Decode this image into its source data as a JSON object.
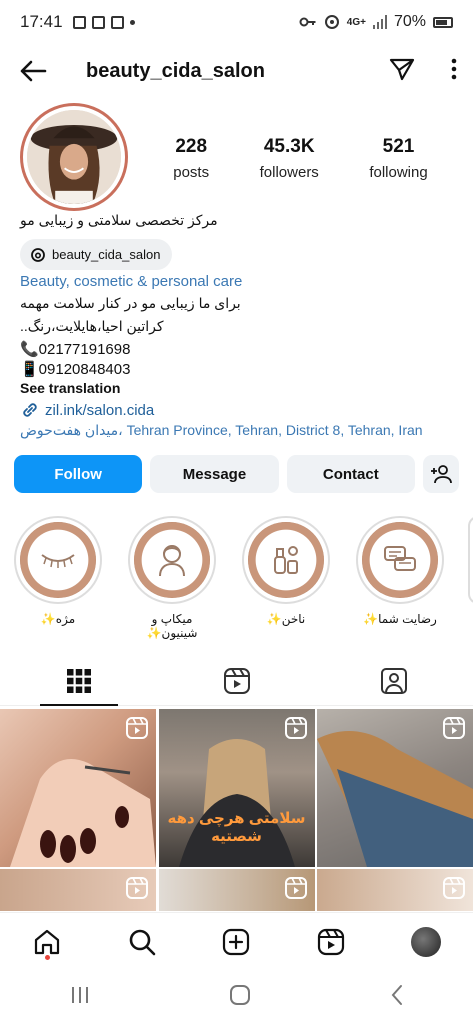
{
  "status_bar": {
    "time": "17:41",
    "battery": "70%",
    "network": "4G+"
  },
  "header": {
    "username": "beauty_cida_salon"
  },
  "profile": {
    "stats": [
      {
        "number": "228",
        "label": "posts"
      },
      {
        "number": "45.3K",
        "label": "followers"
      },
      {
        "number": "521",
        "label": "following"
      }
    ],
    "bio_name": "مرکز تخصصی سلامتی و زیبایی مو",
    "threads_handle": "beauty_cida_salon",
    "category": "Beauty, cosmetic & personal care",
    "bio_lines": [
      "برای ما زیبایی مو در کنار سلامت مهمه",
      "کراتین احیا،هایلایت،رنگ..",
      "📞02177191698",
      "📱09120848403"
    ],
    "see_translation": "See translation",
    "link": "zil.ink/salon.cida",
    "address_fa": "میدان هفت‌حوض،",
    "address_en": " Tehran Province, Tehran, District 8, Tehran, Iran"
  },
  "buttons": {
    "follow": "Follow",
    "message": "Message",
    "contact": "Contact"
  },
  "highlights": [
    {
      "label": "مژه✨",
      "icon": "eyelash-icon"
    },
    {
      "label": "میکاپ و شینیون✨",
      "icon": "makeup-icon"
    },
    {
      "label": "ناخن✨",
      "icon": "nail-polish-icon"
    },
    {
      "label": "رضایت شما✨",
      "icon": "chat-bubbles-icon"
    }
  ],
  "grid_overlay_text": "سلامتی هرچی دهه شصتیه",
  "colors": {
    "primary": "#0d95f7",
    "link": "#1f5f99",
    "category": "#3b78b3",
    "story_ring": "#c96f5c"
  }
}
